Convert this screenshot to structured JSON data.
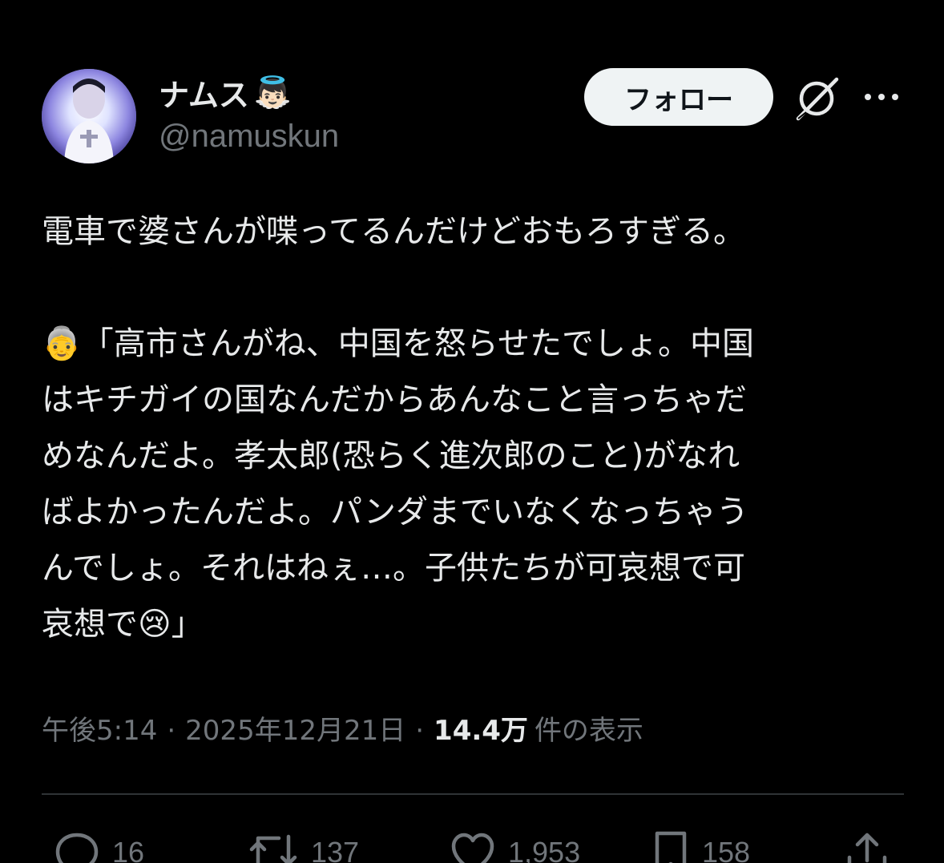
{
  "author": {
    "display_name": "ナムス",
    "name_emoji": "👼🏻",
    "handle": "@namuskun",
    "avatar_icon": "avatar-portrait"
  },
  "header_actions": {
    "follow_label": "フォロー",
    "grok_icon": "grok-icon",
    "more_icon": "more-icon"
  },
  "tweet": {
    "lines": [
      "電車で婆さんが喋ってるんだけどおもろすぎる。",
      "",
      "👵「高市さんがね、中国を怒らせたでしょ。中国",
      "はキチガイの国なんだからあんなこと言っちゃだ",
      "めなんだよ。孝太郎(恐らく進次郎のこと)がなれ",
      "ばよかったんだよ。パンダまでいなくなっちゃう",
      "んでしょ。それはねぇ…。子供たちが可哀想で可",
      "哀想で😢」"
    ]
  },
  "meta": {
    "time": "午後5:14",
    "date": "2025年12月21日",
    "separator": "·",
    "views_count": "14.4万",
    "views_label": "件の表示"
  },
  "actions": {
    "replies": "16",
    "reposts": "137",
    "likes": "1,953",
    "bookmarks": "158"
  },
  "colors": {
    "background": "#000000",
    "primary_text": "#e7e9ea",
    "secondary_text": "#71767b",
    "follow_bg": "#eff3f4",
    "divider": "#2f3336"
  }
}
